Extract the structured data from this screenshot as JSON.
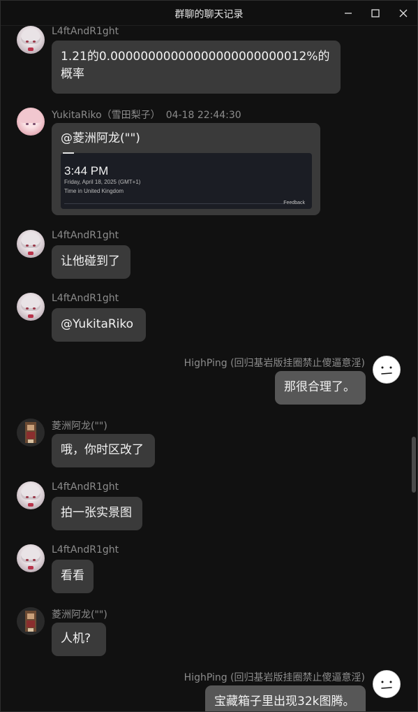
{
  "window": {
    "title": "群聊的聊天记录",
    "controls": [
      "minimize-icon",
      "maximize-icon",
      "close-icon"
    ]
  },
  "messages": [
    {
      "side": "left",
      "avatar": "l4ft-avatar",
      "name": "L4ftAndR1ght",
      "time": "",
      "text": "1.21的0.00000000000000000000000012%的概率"
    },
    {
      "side": "left",
      "avatar": "yukita-avatar",
      "name": "YukitaRiko（雪田梨子）",
      "time": "04-18 22:44:30",
      "text": "@菱洲阿龙(\"\")",
      "card": {
        "time": "3:44 PM",
        "date": "Friday, April 18, 2025 (GMT+1)",
        "location": "Time in United Kingdom",
        "feedback": "Feedback"
      }
    },
    {
      "side": "left",
      "avatar": "l4ft-avatar",
      "name": "L4ftAndR1ght",
      "time": "",
      "text": "让他碰到了"
    },
    {
      "side": "left",
      "avatar": "l4ft-avatar",
      "name": "L4ftAndR1ght",
      "time": "",
      "text": "@YukitaRiko"
    },
    {
      "side": "right",
      "avatar": "highping-avatar",
      "name": "HighPing (回归基岩版挂圈禁止傻逼意淫)",
      "time": "",
      "text": "那很合理了。"
    },
    {
      "side": "left",
      "avatar": "lingzhou-avatar",
      "name": "菱洲阿龙(\"\")",
      "time": "",
      "text": "哦，你时区改了"
    },
    {
      "side": "left",
      "avatar": "l4ft-avatar",
      "name": "L4ftAndR1ght",
      "time": "",
      "text": "拍一张实景图"
    },
    {
      "side": "left",
      "avatar": "l4ft-avatar",
      "name": "L4ftAndR1ght",
      "time": "",
      "text": "看看"
    },
    {
      "side": "left",
      "avatar": "lingzhou-avatar",
      "name": "菱洲阿龙(\"\")",
      "time": "",
      "text": "人机?"
    },
    {
      "side": "right",
      "avatar": "highping-avatar",
      "name": "HighPing (回归基岩版挂圈禁止傻逼意淫)",
      "time": "",
      "text": "宝藏箱子里出现32k图腾。"
    }
  ],
  "colors": {
    "background": "#111111",
    "bubble": "#3a3a3a",
    "bubble_self": "#575757",
    "name_text": "#8c8c8c"
  }
}
